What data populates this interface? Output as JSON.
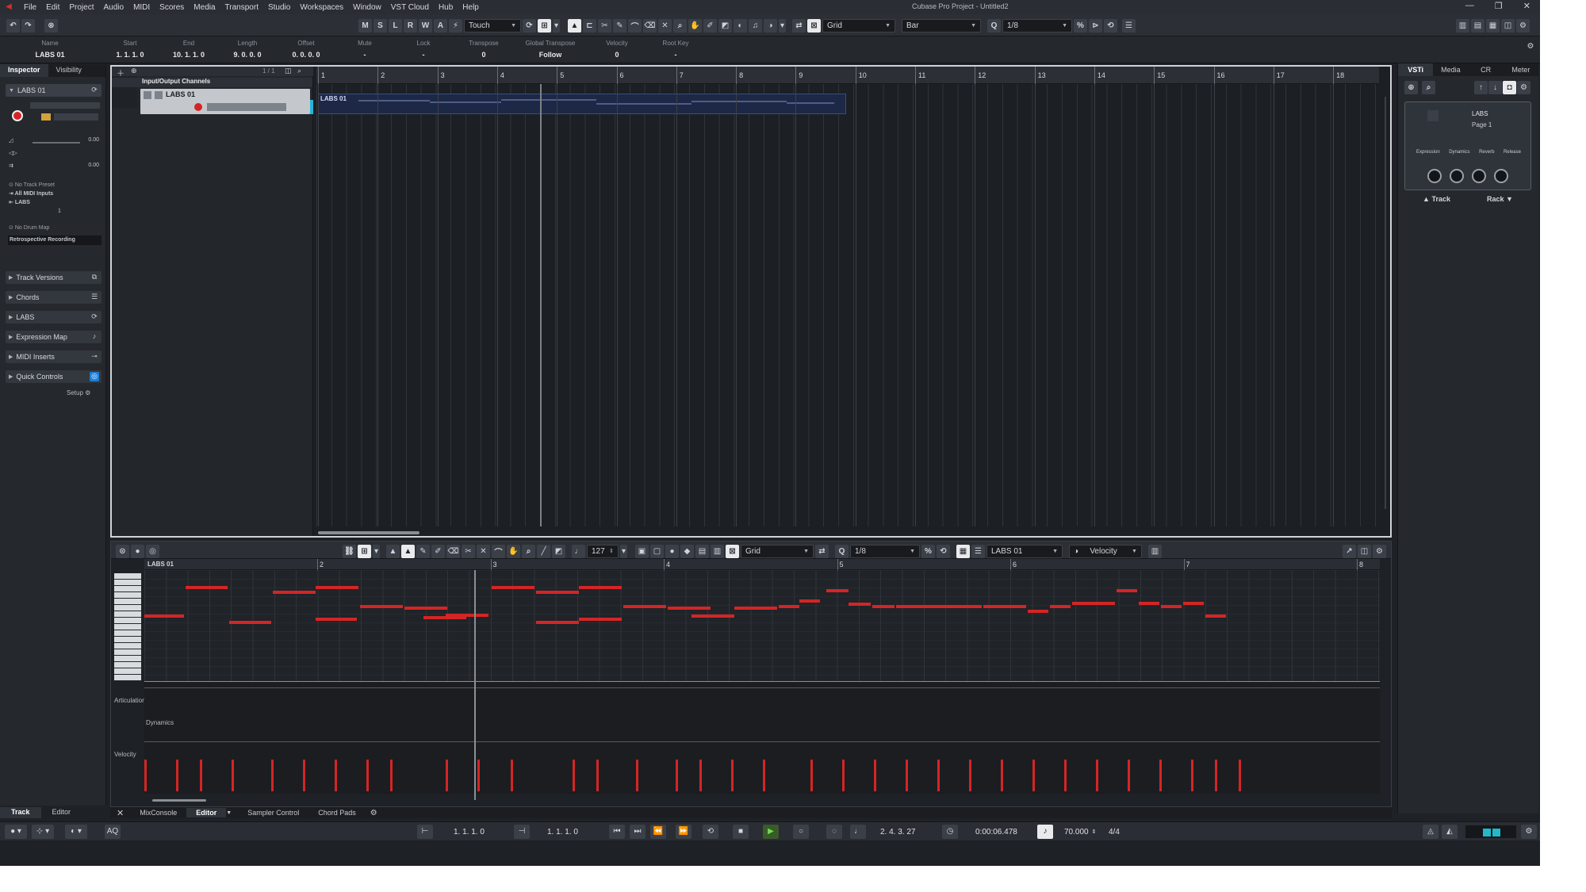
{
  "window": {
    "title": "Cubase Pro Project - Untitled2",
    "controls": [
      "—",
      "❐",
      "✕"
    ]
  },
  "menu": [
    "File",
    "Edit",
    "Project",
    "Audio",
    "MIDI",
    "Scores",
    "Media",
    "Transport",
    "Studio",
    "Workspaces",
    "Window",
    "VST Cloud",
    "Hub",
    "Help"
  ],
  "toolbar": {
    "state_buttons": [
      "M",
      "S",
      "L",
      "R",
      "W",
      "A"
    ],
    "automation_mode": "Touch",
    "snap_type": "Grid",
    "grid_type": "Bar",
    "quantize": "1/8"
  },
  "infoline": [
    {
      "label": "Name",
      "value": "LABS 01"
    },
    {
      "label": "Start",
      "value": "1. 1. 1. 0"
    },
    {
      "label": "End",
      "value": "10. 1. 1. 0"
    },
    {
      "label": "Length",
      "value": "9. 0. 0. 0"
    },
    {
      "label": "Offset",
      "value": "0. 0. 0. 0"
    },
    {
      "label": "Mute",
      "value": "-"
    },
    {
      "label": "Lock",
      "value": "-"
    },
    {
      "label": "Transpose",
      "value": "0"
    },
    {
      "label": "Global Transpose",
      "value": "Follow"
    },
    {
      "label": "Velocity",
      "value": "0"
    },
    {
      "label": "Root Key",
      "value": "-"
    }
  ],
  "inspector": {
    "tabs": [
      "Inspector",
      "Visibility"
    ],
    "track_name": "LABS 01",
    "vol_value": "0.00",
    "pan_value": "0.00",
    "track_preset": "No Track Preset",
    "midi_input": "All MIDI Inputs",
    "output": "LABS",
    "channel": "1",
    "drum_map": "No Drum Map",
    "retro": "Retrospective Recording",
    "sections": [
      "Track Versions",
      "Chords",
      "LABS",
      "Expression Map",
      "MIDI Inserts",
      "Quick Controls"
    ],
    "setup_label": "Setup"
  },
  "project": {
    "io_label": "Input/Output Channels",
    "track_name": "LABS 01",
    "track_count": "1 / 1",
    "part_label": "LABS 01",
    "bars": [
      "1",
      "2",
      "3",
      "4",
      "5",
      "6",
      "7",
      "8",
      "9",
      "10",
      "11",
      "12",
      "13",
      "14",
      "15",
      "16",
      "17",
      "18"
    ]
  },
  "rightzone": {
    "tabs": [
      "VSTi",
      "Media",
      "CR",
      "Meter"
    ],
    "instrument_name": "LABS",
    "page": "Page 1",
    "knob_labels": [
      "Expression",
      "Dynamics",
      "Reverb",
      "Release"
    ],
    "footer": [
      "Track",
      "Rack"
    ]
  },
  "keyeditor": {
    "velocity_value": "127",
    "snap": "Grid",
    "quantize": "1/8",
    "part": "LABS 01",
    "lane": "Velocity",
    "part_label": "LABS 01",
    "bars": [
      "2",
      "3",
      "4",
      "5",
      "6",
      "7",
      "8"
    ],
    "lanes": [
      "Articulations",
      "Dynamics",
      "Velocity"
    ]
  },
  "bottom_tabs": [
    "MixConsole",
    "Editor",
    "Sampler Control",
    "Chord Pads"
  ],
  "left_tabs": [
    "Track",
    "Editor"
  ],
  "transport": {
    "left_locator": "1. 1. 1. 0",
    "right_locator": "1. 1. 1. 0",
    "position": "2. 4. 3. 27",
    "time": "0:00:06.478",
    "tempo": "70.000",
    "signature": "4/4"
  }
}
